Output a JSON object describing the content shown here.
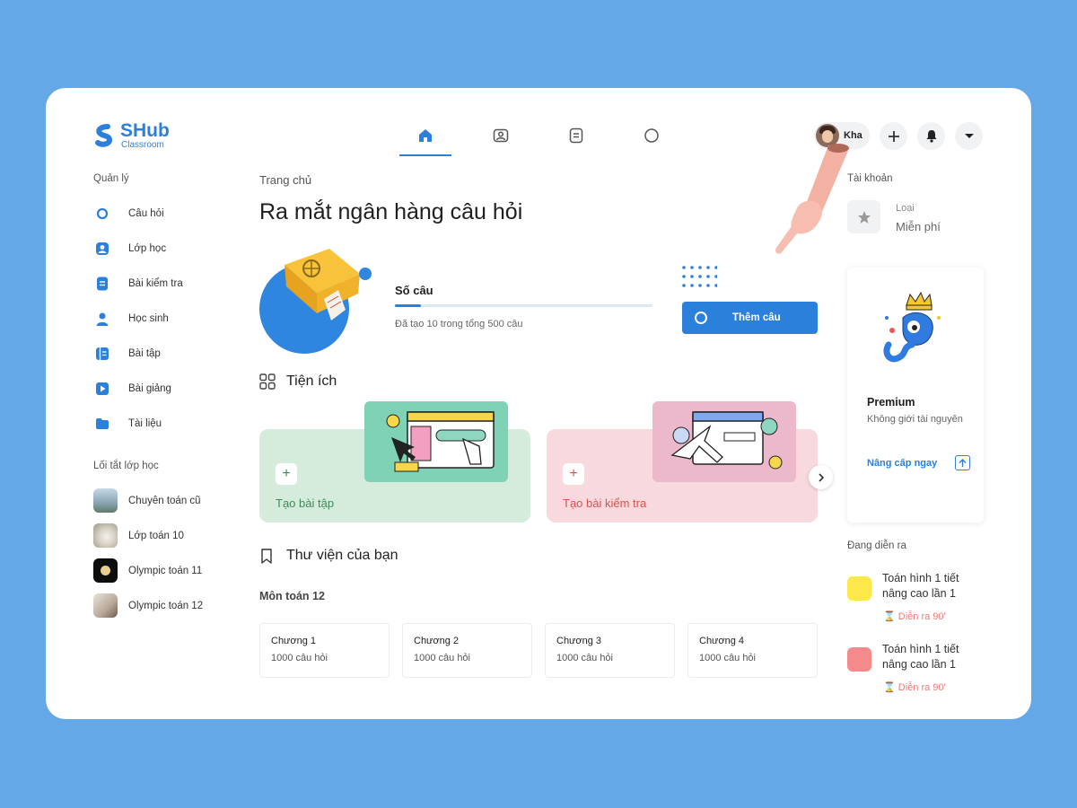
{
  "app": {
    "name": "SHub",
    "subtitle": "Classroom"
  },
  "topnav": {
    "tabs": [
      {
        "icon": "home-icon",
        "active": true
      },
      {
        "icon": "contact-icon",
        "active": false
      },
      {
        "icon": "document-icon",
        "active": false
      },
      {
        "icon": "circle-icon",
        "active": false
      }
    ],
    "user_name": "Kha"
  },
  "sidebar": {
    "manage_heading": "Quản lý",
    "items": [
      {
        "label": "Câu hỏi",
        "icon": "question-ring-icon"
      },
      {
        "label": "Lớp học",
        "icon": "classroom-icon"
      },
      {
        "label": "Bài kiểm tra",
        "icon": "test-icon"
      },
      {
        "label": "Học sinh",
        "icon": "student-icon"
      },
      {
        "label": "Bài tập",
        "icon": "exercise-icon"
      },
      {
        "label": "Bài giảng",
        "icon": "lecture-play-icon"
      },
      {
        "label": "Tài liệu",
        "icon": "folder-icon"
      }
    ],
    "shortcut_heading": "Lối tắt lớp học",
    "shortcuts": [
      {
        "label": "Chuyên toán cũ",
        "color": "#8fa7b8"
      },
      {
        "label": "Lớp toán 10",
        "color": "#c9c3b8"
      },
      {
        "label": "Olympic toán 11",
        "color": "#111111"
      },
      {
        "label": "Olympic toán 12",
        "color": "#b7a89a"
      }
    ]
  },
  "main": {
    "breadcrumb": "Trang chủ",
    "title": "Ra mắt ngân hàng câu hỏi",
    "progress": {
      "label": "Số câu",
      "created": 10,
      "total": 500,
      "description": "Đã tạo 10 trong tổng 500 câu"
    },
    "add_button": "Thêm câu",
    "utilities_heading": "Tiện ích",
    "utilities": [
      {
        "label": "Tạo bài tập",
        "bg": "#d5ecdc",
        "color": "#3b8a5a"
      },
      {
        "label": "Tạo bài kiểm tra",
        "bg": "#f8d9de",
        "color": "#d9534f"
      }
    ],
    "library_heading": "Thư viện của bạn",
    "subject": "Môn toán 12",
    "chapters": [
      {
        "title": "Chương 1",
        "count": "1000 câu hỏi"
      },
      {
        "title": "Chương 2",
        "count": "1000 câu hỏi"
      },
      {
        "title": "Chương 3",
        "count": "1000 câu hỏi"
      },
      {
        "title": "Chương 4",
        "count": "1000 câu hỏi"
      }
    ]
  },
  "account": {
    "heading": "Tài khoản",
    "plan_type_label": "Loại",
    "plan_value": "Miễn phí",
    "premium_title": "Premium",
    "premium_desc": "Không giới tài nguyên",
    "upgrade_label": "Nâng cấp ngay"
  },
  "ongoing": {
    "heading": "Đang diễn ra",
    "events": [
      {
        "title": "Toán hình 1 tiết nâng cao lần 1",
        "time": "Diễn ra 90'",
        "color": "#fde84a"
      },
      {
        "title": "Toán hình 1 tiết nâng cao lần 1",
        "time": "Diễn ra 90'",
        "color": "#f58a8a"
      }
    ]
  }
}
